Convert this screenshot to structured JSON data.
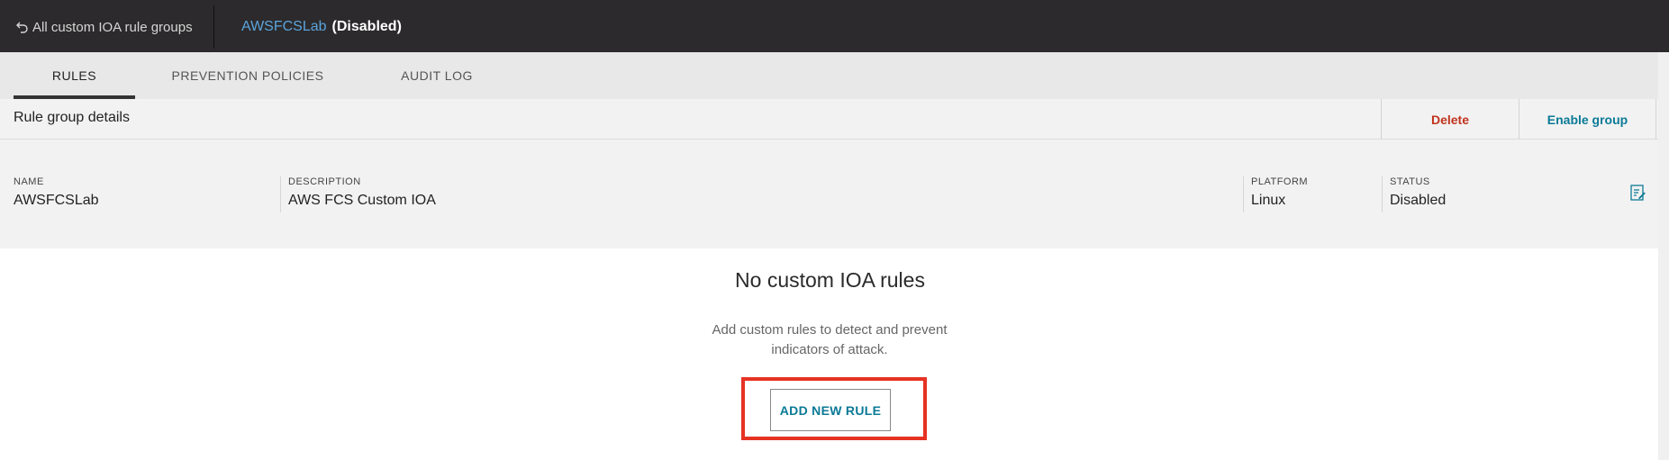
{
  "topbar": {
    "back_label": "All custom IOA rule groups",
    "group_name": "AWSFCSLab",
    "group_status": "(Disabled)"
  },
  "tabs": [
    {
      "label": "RULES",
      "active": true
    },
    {
      "label": "PREVENTION POLICIES",
      "active": false
    },
    {
      "label": "AUDIT LOG",
      "active": false
    }
  ],
  "details": {
    "title": "Rule group details",
    "delete_label": "Delete",
    "enable_label": "Enable group",
    "fields": {
      "name": {
        "label": "NAME",
        "value": "AWSFCSLab"
      },
      "description": {
        "label": "DESCRIPTION",
        "value": "AWS FCS Custom IOA"
      },
      "platform": {
        "label": "PLATFORM",
        "value": "Linux"
      },
      "status": {
        "label": "STATUS",
        "value": "Disabled"
      }
    }
  },
  "empty_state": {
    "title": "No custom IOA rules",
    "line1": "Add custom rules to detect and prevent",
    "line2": "indicators of attack.",
    "button_label": "ADD NEW RULE"
  },
  "colors": {
    "topbar_bg": "#2c2a2c",
    "link_blue": "#5aa4dd",
    "action_teal": "#0b7a96",
    "delete_red": "#c0341d",
    "highlight_red": "#e63223"
  },
  "icons": {
    "back": "undo-arrow-icon",
    "edit": "edit-details-icon"
  }
}
